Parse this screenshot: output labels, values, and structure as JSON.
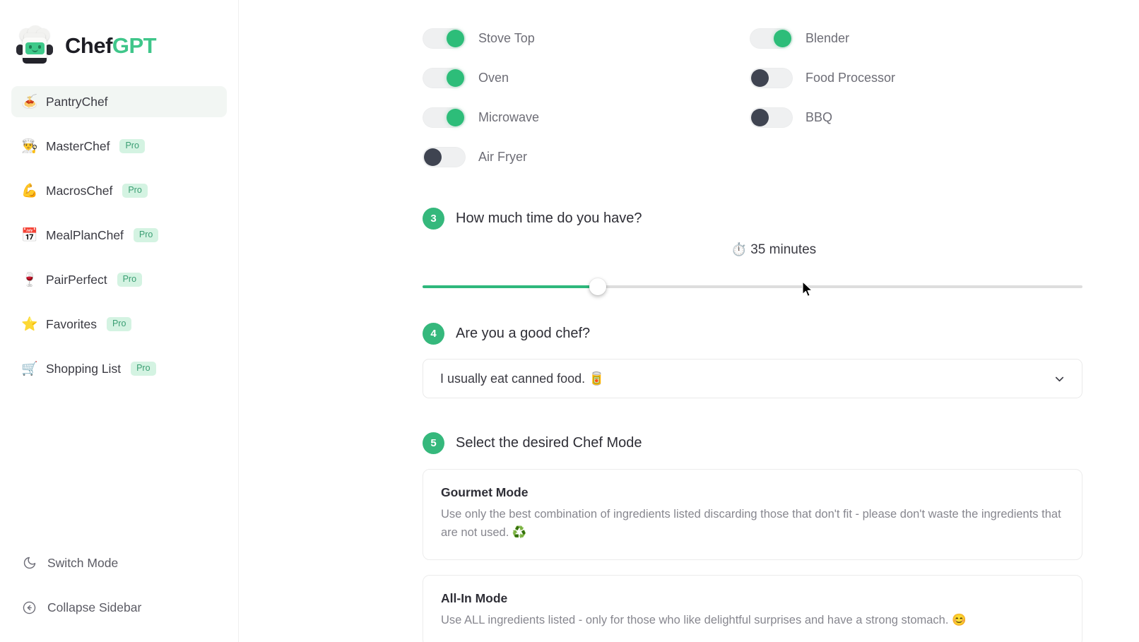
{
  "brand": {
    "name_primary": "Chef",
    "name_accent": "GPT",
    "logo_icon": "chef-robot-logo",
    "accent_color": "#3fc68a"
  },
  "sidebar": {
    "items": [
      {
        "label": "PantryChef",
        "emoji": "🍝",
        "icon": "pantry-icon",
        "badge": "",
        "active": true
      },
      {
        "label": "MasterChef",
        "emoji": "👨‍🍳",
        "icon": "chef-icon",
        "badge": "Pro",
        "active": false
      },
      {
        "label": "MacrosChef",
        "emoji": "💪",
        "icon": "muscle-icon",
        "badge": "Pro",
        "active": false
      },
      {
        "label": "MealPlanChef",
        "emoji": "📅",
        "icon": "calendar-icon",
        "badge": "Pro",
        "active": false
      },
      {
        "label": "PairPerfect",
        "emoji": "🍷",
        "icon": "wine-glass-icon",
        "badge": "Pro",
        "active": false
      },
      {
        "label": "Favorites",
        "emoji": "⭐",
        "icon": "star-icon",
        "badge": "Pro",
        "active": false
      },
      {
        "label": "Shopping List",
        "emoji": "🛒",
        "icon": "cart-icon",
        "badge": "Pro",
        "active": false
      }
    ],
    "bottom": [
      {
        "label": "Switch Mode",
        "icon": "moon-icon"
      },
      {
        "label": "Collapse Sidebar",
        "icon": "arrow-left-circle-icon"
      }
    ],
    "badge_text": "Pro",
    "badge_bg": "#d4f3e2",
    "badge_color": "#3a9e73",
    "active_bg": "#f2f6f3"
  },
  "appliances": {
    "left": [
      {
        "label": "Stove Top",
        "on": true
      },
      {
        "label": "Oven",
        "on": true
      },
      {
        "label": "Microwave",
        "on": true
      },
      {
        "label": "Air Fryer",
        "on": false
      }
    ],
    "right": [
      {
        "label": "Blender",
        "on": true
      },
      {
        "label": "Food Processor",
        "on": false
      },
      {
        "label": "BBQ",
        "on": false
      }
    ],
    "on_color": "#2dbd79",
    "off_color": "#3f4451",
    "track_color": "#eff0f1"
  },
  "step3": {
    "number": "3",
    "title": "How much time do you have?",
    "clock_icon": "⏱️",
    "value_label": "35 minutes",
    "value_minutes": 35,
    "fill_percent": 26.5
  },
  "step4": {
    "number": "4",
    "title": "Are you a good chef?",
    "selected_option": "I usually eat canned food. 🥫",
    "chevron_icon": "chevron-down-icon"
  },
  "step5": {
    "number": "5",
    "title": "Select the desired Chef Mode",
    "modes": [
      {
        "title": "Gourmet Mode",
        "description": "Use only the best combination of ingredients listed discarding those that don't fit - please don't waste the ingredients that are not used. ♻️"
      },
      {
        "title": "All-In Mode",
        "description": "Use ALL ingredients listed - only for those who like delightful surprises and have a strong stomach. 😊"
      }
    ]
  },
  "theme": {
    "step_badge_color": "#35b87c",
    "slider_fill_color": "#2eb87c",
    "text_primary": "#2e2e36",
    "text_muted": "#87878f"
  }
}
